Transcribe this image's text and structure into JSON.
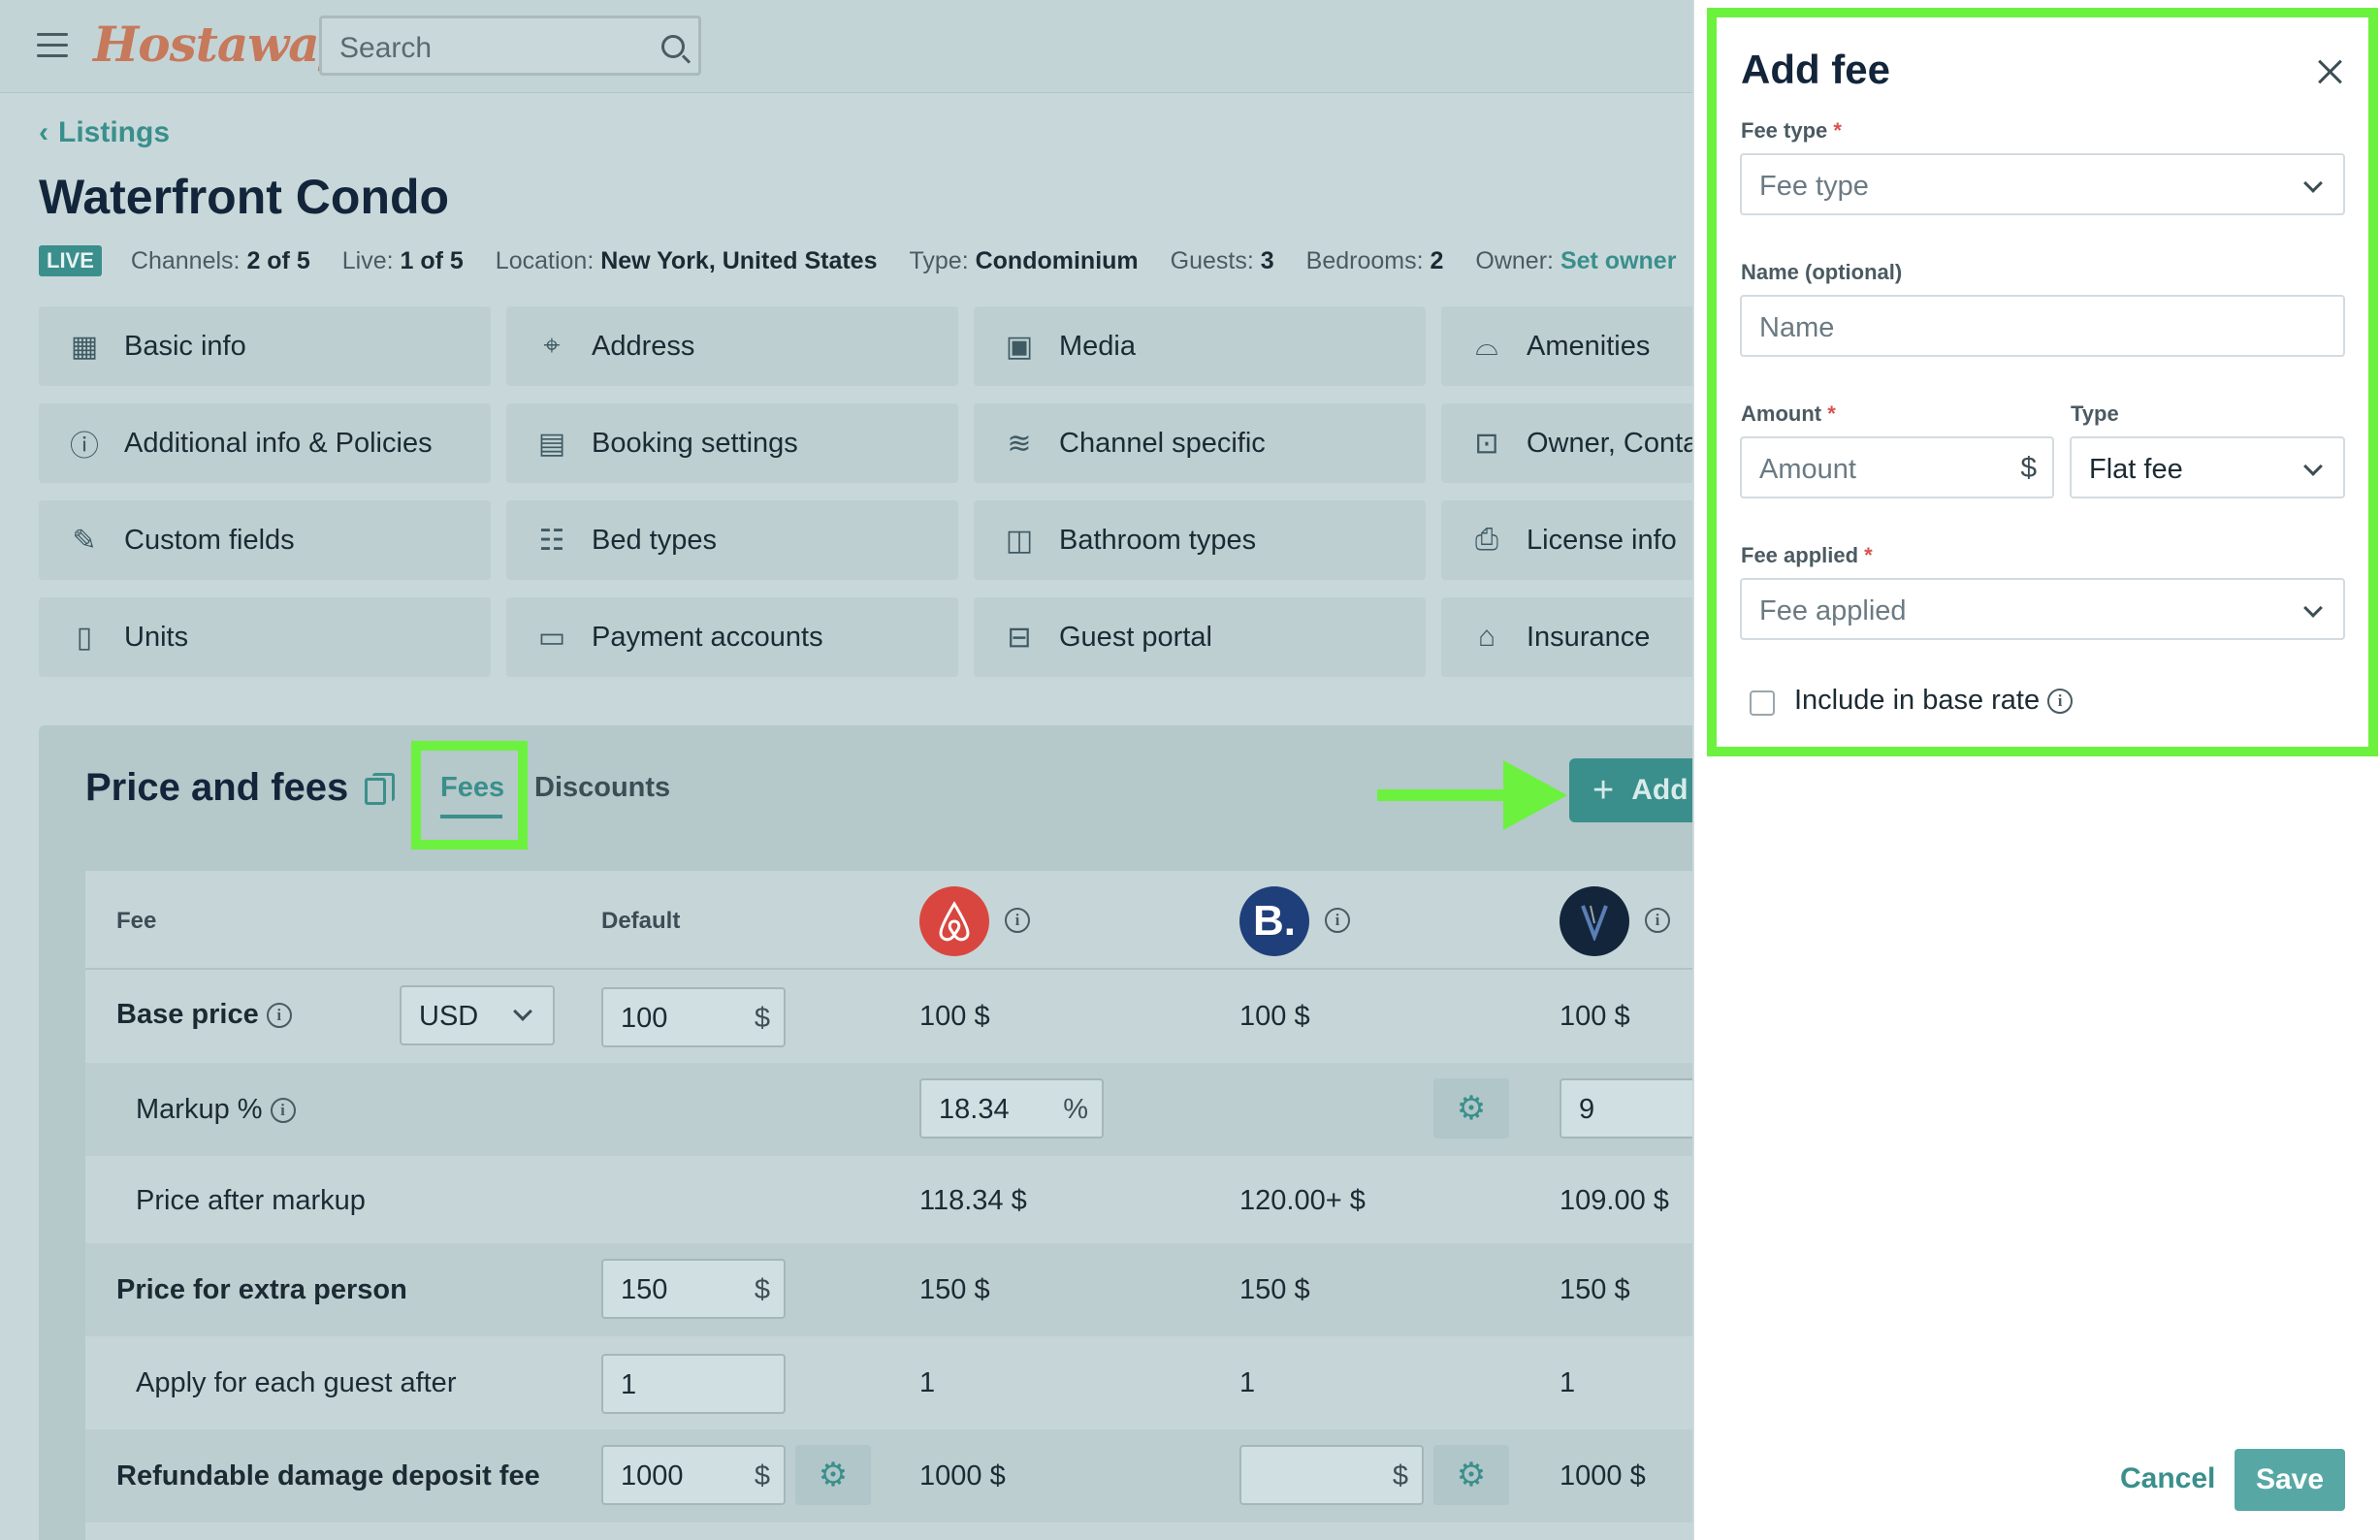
{
  "header": {
    "logo": "Hostaway",
    "search_placeholder": "Search"
  },
  "breadcrumb": {
    "back_label": "Listings"
  },
  "listing": {
    "title": "Waterfront Condo",
    "status_badge": "LIVE",
    "meta": [
      {
        "label": "Channels:",
        "value": "2 of 5"
      },
      {
        "label": "Live:",
        "value": "1 of 5"
      },
      {
        "label": "Location:",
        "value": "New York, United States"
      },
      {
        "label": "Type:",
        "value": "Condominium"
      },
      {
        "label": "Guests:",
        "value": "3"
      },
      {
        "label": "Bedrooms:",
        "value": "2"
      },
      {
        "label": "Owner:",
        "value": "Set owner"
      }
    ]
  },
  "nav_tiles": [
    {
      "label": "Basic info",
      "icon": "building-icon"
    },
    {
      "label": "Address",
      "icon": "map-pin-icon"
    },
    {
      "label": "Media",
      "icon": "image-icon"
    },
    {
      "label": "Amenities",
      "icon": "bell-icon"
    },
    {
      "label": "Additional info & Policies",
      "icon": "info-icon"
    },
    {
      "label": "Booking settings",
      "icon": "calendar-icon"
    },
    {
      "label": "Channel specific",
      "icon": "layers-icon"
    },
    {
      "label": "Owner, Conta",
      "icon": "contact-icon"
    },
    {
      "label": "Custom fields",
      "icon": "edit-icon"
    },
    {
      "label": "Bed types",
      "icon": "bed-icon"
    },
    {
      "label": "Bathroom types",
      "icon": "bathtub-icon"
    },
    {
      "label": "License info",
      "icon": "license-icon"
    },
    {
      "label": "Units",
      "icon": "unit-icon"
    },
    {
      "label": "Payment accounts",
      "icon": "card-icon"
    },
    {
      "label": "Guest portal",
      "icon": "briefcase-icon"
    },
    {
      "label": "Insurance",
      "icon": "home-shield-icon"
    }
  ],
  "price_fees": {
    "title": "Price and fees",
    "tabs": [
      "Fees",
      "Discounts"
    ],
    "add_button": "Add",
    "columns": {
      "fee": "Fee",
      "default": "Default"
    },
    "rows": {
      "base_price": {
        "label": "Base price",
        "currency": "USD",
        "default": "100",
        "unit": "$",
        "ch1": "100 $",
        "ch2": "100 $",
        "ch3": "100 $"
      },
      "markup": {
        "label": "Markup %",
        "ch1_value": "18.34",
        "ch1_unit": "%",
        "ch3_value": "9"
      },
      "price_after_markup": {
        "label": "Price after markup",
        "ch1": "118.34 $",
        "ch2": "120.00+ $",
        "ch3": "109.00 $"
      },
      "extra_person": {
        "label": "Price for extra person",
        "default": "150",
        "unit": "$",
        "ch1": "150 $",
        "ch2": "150 $",
        "ch3": "150 $"
      },
      "guest_after": {
        "label": "Apply for each guest after",
        "default": "1",
        "ch1": "1",
        "ch2": "1",
        "ch3": "1"
      },
      "damage_deposit": {
        "label": "Refundable damage deposit fee",
        "default": "1000",
        "unit": "$",
        "ch1": "1000 $",
        "ch2_unit": "$",
        "ch3": "1000 $"
      }
    },
    "channel_logos": {
      "ch2_letter": "B."
    }
  },
  "drawer": {
    "title": "Add fee",
    "fee_type": {
      "label": "Fee type",
      "required": "*",
      "placeholder": "Fee type"
    },
    "name": {
      "label": "Name (optional)",
      "placeholder": "Name"
    },
    "amount": {
      "label": "Amount",
      "required": "*",
      "placeholder": "Amount",
      "suffix": "$"
    },
    "type": {
      "label": "Type",
      "value": "Flat fee"
    },
    "fee_applied": {
      "label": "Fee applied",
      "required": "*",
      "placeholder": "Fee applied"
    },
    "include_base_rate": {
      "label": "Include in base rate",
      "checked": false
    },
    "cancel_label": "Cancel",
    "save_label": "Save"
  },
  "colors": {
    "accent": "#3a8f8c",
    "highlight": "#6cf23e",
    "airbnb": "#d9463f",
    "booking": "#1f3f7a",
    "vrbo": "#13253a"
  }
}
